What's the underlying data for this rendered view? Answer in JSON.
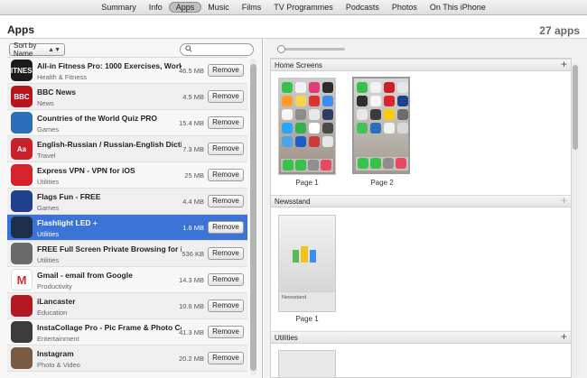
{
  "tabs": [
    "Summary",
    "Info",
    "Apps",
    "Music",
    "Films",
    "TV Programmes",
    "Podcasts",
    "Photos",
    "On This iPhone"
  ],
  "active_tab": "Apps",
  "header": {
    "title": "Apps",
    "count": "27 apps"
  },
  "left": {
    "sort_label": "Sort by Name",
    "search_placeholder": "",
    "remove_label": "Remove",
    "apps": [
      {
        "name": "All-in Fitness Pro: 1000 Exercises, Workouts...",
        "category": "Health & Fitness",
        "size": "46.5 MB",
        "icon_color": "#1b1b1b",
        "icon_text": "FITNESS",
        "icon_name": "fitness-app-icon"
      },
      {
        "name": "BBC News",
        "category": "News",
        "size": "4.5 MB",
        "icon_color": "#b7141d",
        "icon_text": "BBC",
        "icon_name": "bbc-news-app-icon"
      },
      {
        "name": "Countries of the World Quiz PRO",
        "category": "Games",
        "size": "15.4 MB",
        "icon_color": "#2a6fb8",
        "icon_text": "",
        "icon_name": "globe-quiz-app-icon"
      },
      {
        "name": "English-Russian / Russian-English Dictionary",
        "category": "Travel",
        "size": "7.3 MB",
        "icon_color": "#c9212a",
        "icon_text": "Aa",
        "icon_name": "dictionary-app-icon"
      },
      {
        "name": "Express VPN - VPN for iOS",
        "category": "Utilities",
        "size": "25 MB",
        "icon_color": "#d6222a",
        "icon_text": "",
        "icon_name": "vpn-app-icon"
      },
      {
        "name": "Flags Fun - FREE",
        "category": "Games",
        "size": "4.4 MB",
        "icon_color": "#1f3f8f",
        "icon_text": "",
        "icon_name": "flag-app-icon"
      },
      {
        "name": "Flashlight  LED +",
        "category": "Utilities",
        "size": "1.6 MB",
        "icon_color": "#1d2f49",
        "icon_text": "",
        "icon_name": "flashlight-app-icon"
      },
      {
        "name": "FREE Full Screen Private Browsing for iPhone...",
        "category": "Utilities",
        "size": "536 KB",
        "icon_color": "#6a6a6a",
        "icon_text": "",
        "icon_name": "browser-app-icon"
      },
      {
        "name": "Gmail - email from Google",
        "category": "Productivity",
        "size": "14.3 MB",
        "icon_color": "#ffffff",
        "icon_text": "M",
        "icon_name": "gmail-app-icon"
      },
      {
        "name": "iLancaster",
        "category": "Education",
        "size": "10.6 MB",
        "icon_color": "#b41822",
        "icon_text": "",
        "icon_name": "lancaster-app-icon"
      },
      {
        "name": "InstaCollage Pro - Pic Frame & Photo Collage...",
        "category": "Entertainment",
        "size": "41.3 MB",
        "icon_color": "#3b3b3b",
        "icon_text": "",
        "icon_name": "camera-app-icon"
      },
      {
        "name": "Instagram",
        "category": "Photo & Video",
        "size": "20.2 MB",
        "icon_color": "#7a5a40",
        "icon_text": "",
        "icon_name": "instagram-app-icon"
      }
    ],
    "selected_index": 6
  },
  "right": {
    "sections": [
      {
        "title": "Home Screens"
      },
      {
        "title": "Newsstand"
      },
      {
        "title": "Utilities"
      }
    ],
    "pages": [
      "Page 1",
      "Page 2"
    ],
    "newsstand_page": "Page 1",
    "newsstand_shelf_label": "Newsstand"
  },
  "colors": {
    "selection": "#3b73d6"
  }
}
